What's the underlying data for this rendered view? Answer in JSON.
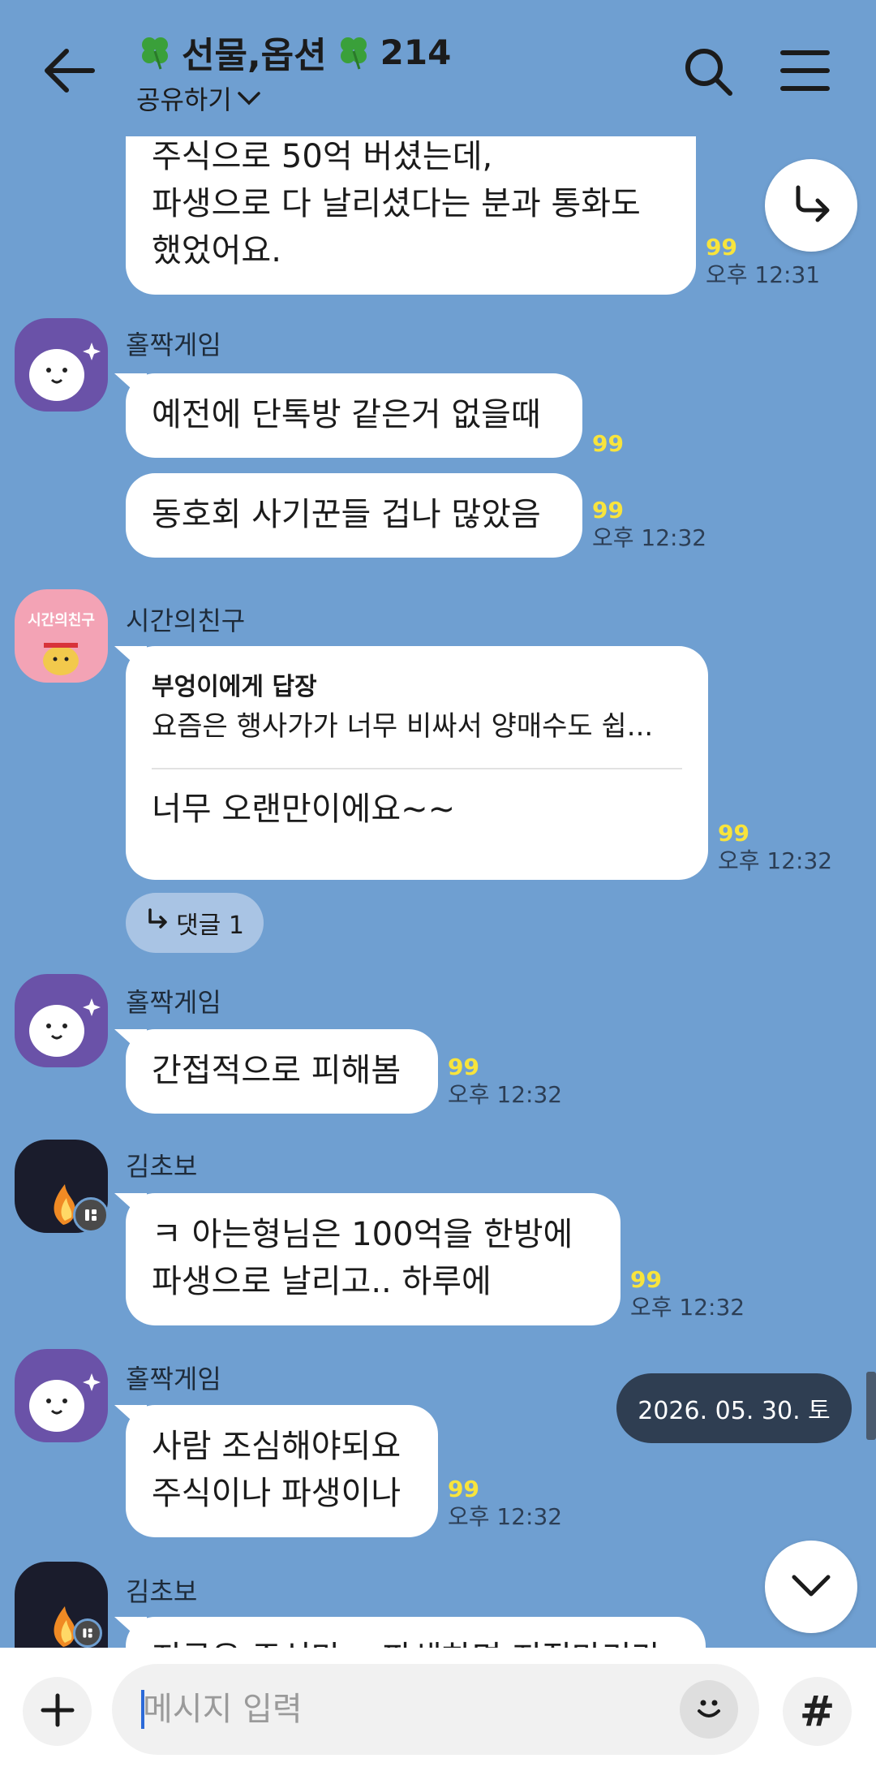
{
  "header": {
    "title": "선물,옵션",
    "member_count": "214",
    "share_label": "공유하기"
  },
  "messages": [
    {
      "text": "주식으로 50억 버셨는데,\n파생으로 다 날리셨다는 분과 통화도\n했었어요.",
      "unread": "99",
      "time": "오후 12:31"
    },
    {
      "sender": "홀짝게임",
      "text": "예전에 단톡방 같은거 없을때",
      "unread": "99"
    },
    {
      "text": "동호회 사기꾼들 겁나 많았음",
      "unread": "99",
      "time": "오후 12:32"
    },
    {
      "sender": "시간의친구",
      "reply_to": "부엉이에게 답장",
      "reply_preview": "요즘은 행사가가 너무 비싸서 양매수도 쉽...",
      "text": "너무 오랜만이에요~~",
      "unread": "99",
      "time": "오후 12:32",
      "thread_label": "댓글 1"
    },
    {
      "sender": "홀짝게임",
      "text": "간접적으로 피해봄",
      "unread": "99",
      "time": "오후 12:32"
    },
    {
      "sender": "김초보",
      "text": "ㅋ 아는형님은 100억을 한방에\n파생으로 날리고.. 하루에",
      "unread": "99",
      "time": "오후 12:32"
    },
    {
      "sender": "홀짝게임",
      "text": "사람 조심해야되요\n주식이나 파생이나",
      "unread": "99",
      "time": "오후 12:32"
    },
    {
      "sender": "김초보",
      "text": "지금은 주식만... 파생하면 지질마리라"
    }
  ],
  "avatar_text": "시간의친구",
  "date_indicator": "2026. 05. 30. 토",
  "input": {
    "placeholder": "메시지 입력"
  },
  "hash_label": "#",
  "colors": {
    "background": "#6f9fd1",
    "unread": "#f8e43c",
    "date_pill": "#2f3e52"
  }
}
